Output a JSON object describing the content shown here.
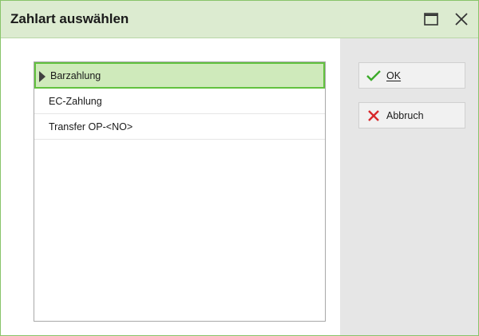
{
  "window": {
    "title": "Zahlart auswählen",
    "maximize_icon": "maximize-icon",
    "close_icon": "close-icon"
  },
  "payment_list": {
    "items": [
      {
        "label": "Barzahlung",
        "selected": true
      },
      {
        "label": "EC-Zahlung",
        "selected": false
      },
      {
        "label": "Transfer OP-<NO>",
        "selected": false
      }
    ]
  },
  "buttons": {
    "ok": {
      "label": "OK",
      "icon": "checkmark-icon",
      "icon_color": "#3cab2a"
    },
    "cancel": {
      "label": "Abbruch",
      "icon": "x-icon",
      "icon_color": "#d8282a"
    }
  },
  "colors": {
    "accent": "#62c23f",
    "selected_row": "#cfeabb",
    "titlebar": "#dcebd0"
  }
}
